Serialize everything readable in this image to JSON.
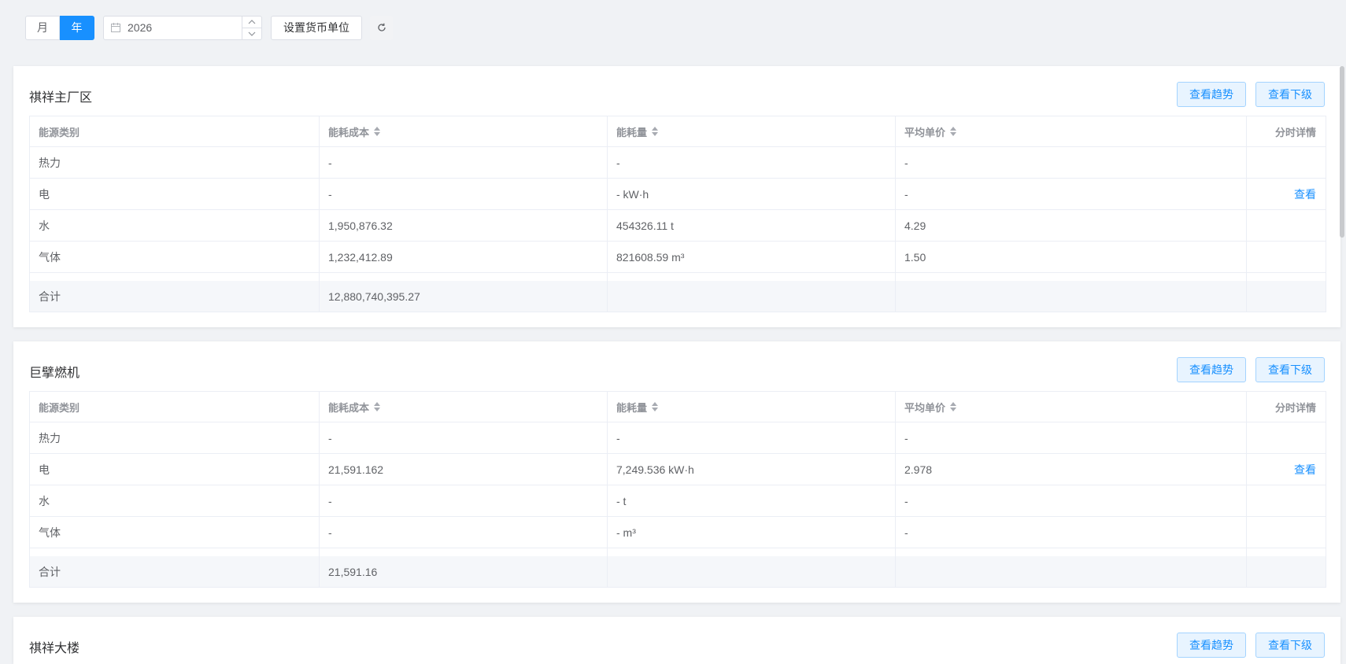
{
  "toolbar": {
    "month_label": "月",
    "year_label": "年",
    "year_value": "2026",
    "currency_label": "设置货币单位"
  },
  "table_headers": {
    "category": "能源类别",
    "cost": "能耗成本",
    "usage": "能耗量",
    "avg_price": "平均单价",
    "detail": "分时详情"
  },
  "actions": {
    "trend": "查看趋势",
    "sub": "查看下级",
    "view": "查看"
  },
  "cards": [
    {
      "title": "祺祥主厂区",
      "rows": [
        {
          "category": "热力",
          "cost": "-",
          "usage": "-",
          "avg_price": "-",
          "detail": ""
        },
        {
          "category": "电",
          "cost": "-",
          "usage": "- kW·h",
          "avg_price": "-",
          "detail": "查看"
        },
        {
          "category": "水",
          "cost": "1,950,876.32",
          "usage": "454326.11 t",
          "avg_price": "4.29",
          "detail": ""
        },
        {
          "category": "气体",
          "cost": "1,232,412.89",
          "usage": "821608.59 m³",
          "avg_price": "1.50",
          "detail": ""
        }
      ],
      "total": {
        "label": "合计",
        "cost": "12,880,740,395.27"
      }
    },
    {
      "title": "巨擘燃机",
      "rows": [
        {
          "category": "热力",
          "cost": "-",
          "usage": "-",
          "avg_price": "-",
          "detail": ""
        },
        {
          "category": "电",
          "cost": "21,591.162",
          "usage": "7,249.536 kW·h",
          "avg_price": "2.978",
          "detail": "查看"
        },
        {
          "category": "水",
          "cost": "-",
          "usage": "- t",
          "avg_price": "-",
          "detail": ""
        },
        {
          "category": "气体",
          "cost": "-",
          "usage": "- m³",
          "avg_price": "-",
          "detail": ""
        }
      ],
      "total": {
        "label": "合计",
        "cost": "21,591.16"
      }
    },
    {
      "title": "祺祥大楼"
    }
  ]
}
